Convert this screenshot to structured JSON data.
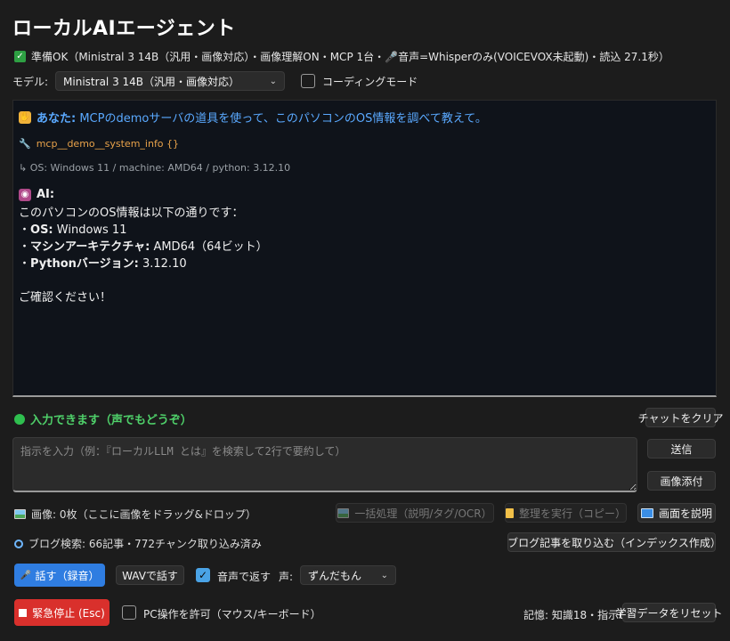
{
  "app": {
    "title": "ローカルAIエージェント"
  },
  "status": {
    "text": "準備OK（Ministral 3 14B（汎用・画像対応）・画像理解ON・MCP 1台・🎤音声=Whisperのみ(VOICEVOX未起動)・読込 27.1秒）"
  },
  "model": {
    "label": "モデル:",
    "selected": "Ministral 3 14B（汎用・画像対応）",
    "coding_mode_label": "コーディングモード",
    "coding_mode_checked": false
  },
  "chat": {
    "user_prefix": "あなた:",
    "user_message": "MCPのdemoサーバの道具を使って、このパソコンのOS情報を調べて教えて。",
    "tool_call": "mcp__demo__system_info {}",
    "tool_result": "↳ OS: Windows 11 / machine: AMD64 / python: 3.12.10",
    "ai_prefix": "AI:",
    "ai_intro": "このパソコンのOS情報は以下の通りです：",
    "ai_items": [
      {
        "bullet": "・",
        "key": "OS:",
        "value": " Windows 11"
      },
      {
        "bullet": "・",
        "key": "マシンアーキテクチャ:",
        "value": " AMD64（64ビット）"
      },
      {
        "bullet": "・",
        "key": "Pythonバージョン:",
        "value": " 3.12.10"
      }
    ],
    "ai_outro": "ご確認ください！"
  },
  "ready": {
    "text": "入力できます（声でもどうぞ）"
  },
  "buttons": {
    "clear_chat": "チャットをクリア",
    "send": "送信",
    "attach_image": "画像添付",
    "batch_process": "一括処理（説明/タグ/OCR）",
    "organize": "整理を実行（コピー）",
    "describe_screen": "画面を説明",
    "import_blog": "ブログ記事を取り込む（インデックス作成）",
    "speak": "話す（録音）",
    "wav_speak": "WAVで話す",
    "voice_reply": "音声で返す",
    "emergency_stop": "緊急停止 (Esc)",
    "allow_pc": "PC操作を許可（マウス/キーボード）",
    "reset_learning": "学習データをリセット"
  },
  "input": {
    "placeholder": "指示を入力（例：『ローカルLLM とは』を検索して2行で要約して）"
  },
  "images": {
    "text": "画像: 0枚（ここに画像をドラッグ&ドロップ）"
  },
  "blog": {
    "text": "ブログ検索: 66記事・772チャンク取り込み済み"
  },
  "voice": {
    "label": "声:",
    "selected": "ずんだもん",
    "reply_checked": true
  },
  "pc_control": {
    "checked": false
  },
  "memory": {
    "text": "記憶: 知識18・指示0"
  },
  "icons": {
    "status": "check-icon",
    "ready": "green-dot-icon",
    "user": "raised-hand-icon",
    "ai": "robot-icon",
    "tool": "wrench-icon"
  },
  "colors": {
    "accent": "#2f7de1",
    "danger": "#d9302c",
    "ready": "#4fd16a",
    "user_text": "#5aa9ff",
    "tool_text": "#e8a24a"
  }
}
